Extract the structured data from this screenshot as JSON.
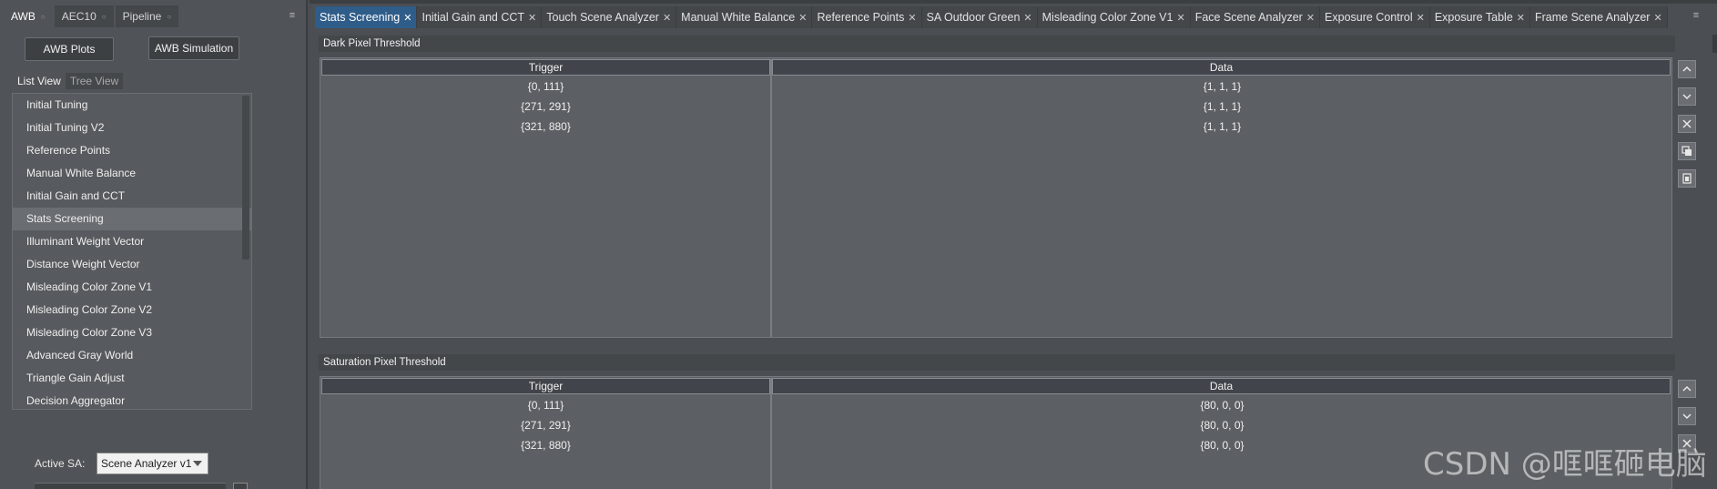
{
  "left_panel": {
    "tabs": [
      {
        "label": "AWB",
        "active": true
      },
      {
        "label": "AEC10",
        "active": false
      },
      {
        "label": "Pipeline",
        "active": false
      }
    ],
    "buttons": {
      "awb_plots": "AWB Plots",
      "awb_simulation": "AWB Simulation"
    },
    "view_tabs": {
      "list_view": "List View",
      "tree_view": "Tree View"
    },
    "items": [
      "Initial Tuning",
      "Initial Tuning V2",
      "Reference Points",
      "Manual White Balance",
      "Initial Gain and CCT",
      "Stats Screening",
      "Illuminant Weight Vector",
      "Distance Weight Vector",
      "Misleading Color Zone V1",
      "Misleading Color Zone V2",
      "Misleading Color Zone V3",
      "Advanced Gray World",
      "Triangle Gain Adjust",
      "Decision Aggregator"
    ],
    "selected_item": "Stats Screening",
    "active_sa": {
      "label": "Active SA:",
      "value": "Scene Analyzer v1"
    }
  },
  "doc_tabs": [
    "Stats Screening",
    "Initial Gain and CCT",
    "Touch Scene Analyzer",
    "Manual White Balance",
    "Reference Points",
    "SA Outdoor Green",
    "Misleading Color Zone V1",
    "Face Scene Analyzer",
    "Exposure Control",
    "Exposure Table",
    "Frame Scene Analyzer"
  ],
  "active_doc_tab": "Stats Screening",
  "sections": [
    {
      "title": "Dark Pixel Threshold",
      "columns": {
        "trigger": "Trigger",
        "data": "Data"
      },
      "rows": [
        {
          "trigger": "{0, 111}",
          "data": "{1, 1, 1}"
        },
        {
          "trigger": "{271, 291}",
          "data": "{1, 1, 1}"
        },
        {
          "trigger": "{321, 880}",
          "data": "{1, 1, 1}"
        }
      ]
    },
    {
      "title": "Saturation Pixel Threshold",
      "columns": {
        "trigger": "Trigger",
        "data": "Data"
      },
      "rows": [
        {
          "trigger": "{0, 111}",
          "data": "{80, 0, 0}"
        },
        {
          "trigger": "{271, 291}",
          "data": "{80, 0, 0}"
        },
        {
          "trigger": "{321, 880}",
          "data": "{80, 0, 0}"
        }
      ]
    }
  ],
  "side_buttons": [
    "move-up-icon",
    "move-down-icon",
    "delete-icon",
    "copy-icon",
    "paste-icon"
  ],
  "watermark": "CSDN @哐哐砸电脑",
  "colors": {
    "active_tab": "#2f5d8a",
    "panel": "#505357",
    "grid": "#5c5f63"
  }
}
